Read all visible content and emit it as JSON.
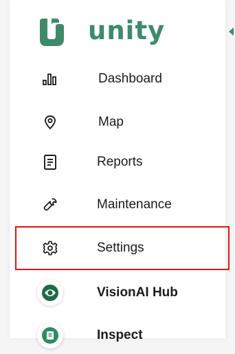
{
  "brand": {
    "name": "unity",
    "color": "#3f8a6b"
  },
  "nav": {
    "items": [
      {
        "label": "Dashboard",
        "icon": "bar-chart-icon"
      },
      {
        "label": "Map",
        "icon": "map-pin-icon"
      },
      {
        "label": "Reports",
        "icon": "document-icon"
      },
      {
        "label": "Maintenance",
        "icon": "wrench-icon"
      },
      {
        "label": "Settings",
        "icon": "gear-icon",
        "highlighted": true
      },
      {
        "label": "VisionAI Hub",
        "icon": "visionai-logo-icon"
      },
      {
        "label": "Inspect",
        "icon": "inspect-logo-icon"
      }
    ]
  },
  "colors": {
    "highlight_border": "#e11414",
    "visionai_green": "#1f6b45",
    "inspect_green": "#2f8b64"
  }
}
